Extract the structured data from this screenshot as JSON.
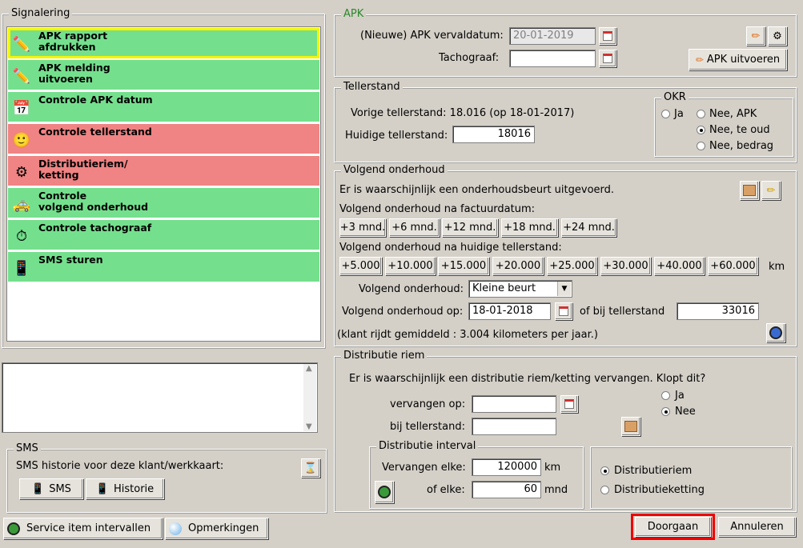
{
  "signalering": {
    "title": "Signalering",
    "items": [
      {
        "label1": "APK rapport",
        "label2": "afdrukken",
        "status": "green",
        "icon": "apk-print-icon"
      },
      {
        "label1": "APK melding",
        "label2": "uitvoeren",
        "status": "green",
        "icon": "apk-report-icon"
      },
      {
        "label1": "Controle APK datum",
        "label2": "",
        "status": "green",
        "icon": "apk-calendar-icon"
      },
      {
        "label1": "Controle tellerstand",
        "label2": "",
        "status": "red",
        "icon": "odometer-icon"
      },
      {
        "label1": "Distributieriem/",
        "label2": "ketting",
        "status": "red",
        "icon": "timing-belt-icon"
      },
      {
        "label1": "Controle",
        "label2": "volgend onderhoud",
        "status": "green",
        "icon": "car-service-icon"
      },
      {
        "label1": "Controle tachograaf",
        "label2": "",
        "status": "green",
        "icon": "tachograph-icon"
      },
      {
        "label1": "SMS sturen",
        "label2": "",
        "status": "green",
        "icon": "mobile-phone-icon"
      }
    ],
    "colors": {
      "green": "#74e08d",
      "red": "#f08383",
      "selected_border": "#f5f500"
    }
  },
  "sms": {
    "title": "SMS",
    "history_text": "SMS historie voor deze klant/werkkaart:",
    "sms_button": "SMS",
    "history_button": "Historie"
  },
  "bottom": {
    "service_items_button": "Service item intervallen",
    "remarks_button": "Opmerkingen",
    "continue_button": "Doorgaan",
    "cancel_button": "Annuleren"
  },
  "apk": {
    "title": "APK",
    "expiry_label": "(Nieuwe) APK vervaldatum:",
    "expiry_value": "20-01-2019",
    "tacho_label": "Tachograaf:",
    "tacho_value": "",
    "execute_button": "APK uitvoeren"
  },
  "tellerstand": {
    "title": "Tellerstand",
    "previous_text": "Vorige tellerstand: 18.016 (op 18-01-2017)",
    "current_label": "Huidige tellerstand:",
    "current_value": "18016",
    "okr": {
      "title": "OKR",
      "ja": "Ja",
      "nee_apk": "Nee, APK",
      "nee_te_oud": "Nee, te oud",
      "nee_bedrag": "Nee, bedrag"
    }
  },
  "onderhoud": {
    "title": "Volgend onderhoud",
    "notice": "Er is waarschijnlijk een onderhoudsbeurt uitgevoerd.",
    "by_invoice_label": "Volgend onderhoud na factuurdatum:",
    "month_buttons": [
      "+3 mnd.",
      "+6 mnd.",
      "+12 mnd.",
      "+18 mnd.",
      "+24 mnd."
    ],
    "by_km_label": "Volgend onderhoud na huidige tellerstand:",
    "km_buttons": [
      "+5.000",
      "+10.000",
      "+15.000",
      "+20.000",
      "+25.000",
      "+30.000",
      "+40.000",
      "+60.000"
    ],
    "km_unit": "km",
    "type_label": "Volgend onderhoud:",
    "type_value": "Kleine beurt",
    "date_label": "Volgend onderhoud op:",
    "date_value": "18-01-2018",
    "or_label": "of bij tellerstand",
    "or_value": "33016",
    "average_text": "(klant rijdt gemiddeld : 3.004 kilometers per jaar.)"
  },
  "distributie": {
    "title": "Distributie riem",
    "question": "Er is waarschijnlijk een distributie riem/ketting vervangen. Klopt dit?",
    "replaced_on_label": "vervangen op:",
    "replaced_on_value": "",
    "at_km_label": "bij tellerstand:",
    "at_km_value": "",
    "ja": "Ja",
    "nee": "Nee",
    "interval": {
      "title": "Distributie interval",
      "every_label": "Vervangen elke:",
      "every_value": "120000",
      "every_unit": "km",
      "or_every_label": "of elke:",
      "or_every_value": "60",
      "or_every_unit": "mnd"
    },
    "belt": "Distributieriem",
    "chain": "Distributieketting"
  }
}
